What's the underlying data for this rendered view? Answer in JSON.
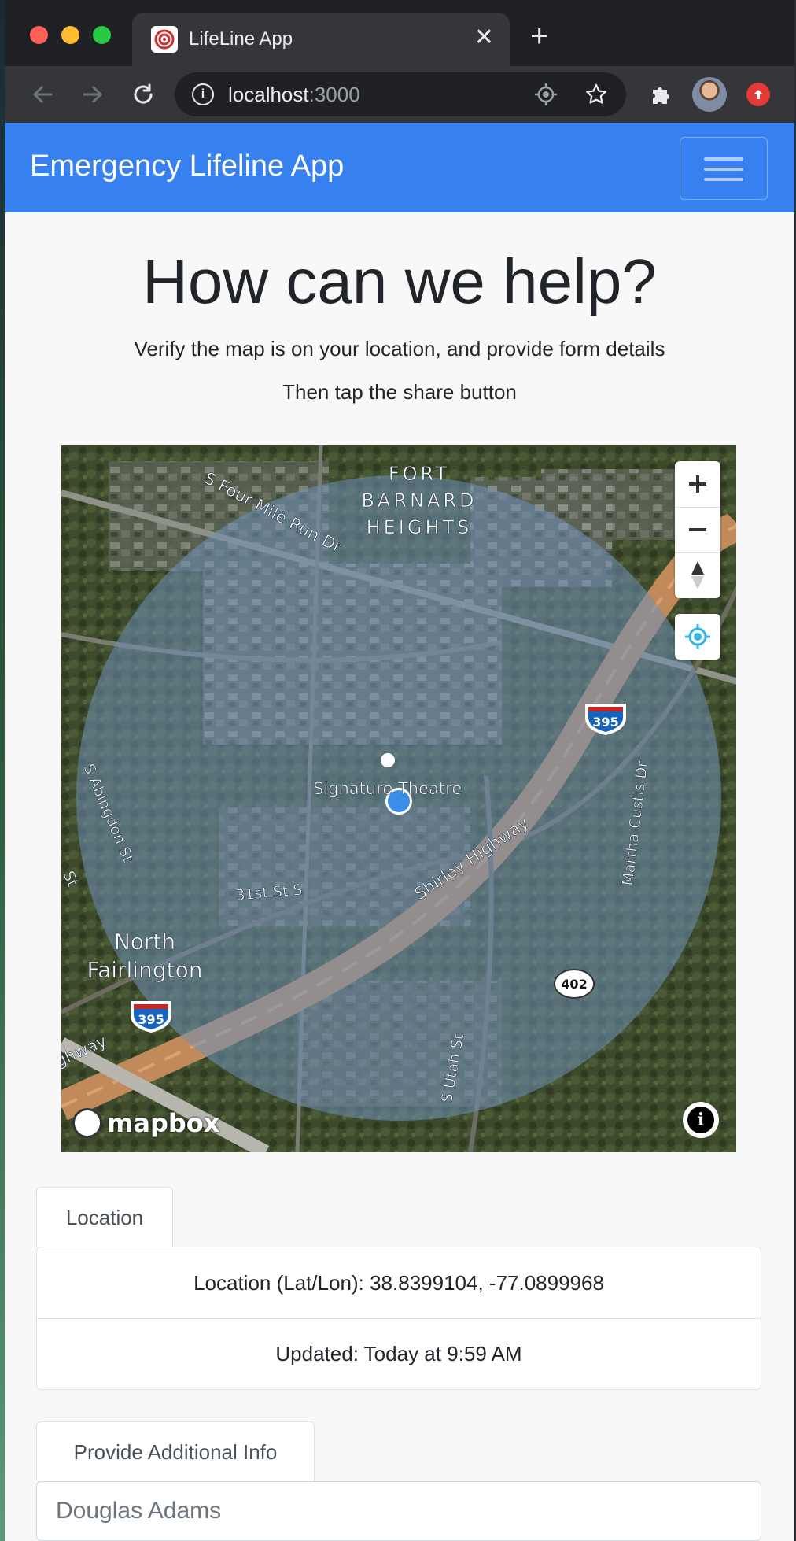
{
  "browser": {
    "tab_title": "LifeLine App",
    "url_host": "localhost",
    "url_port": ":3000"
  },
  "navbar": {
    "brand": "Emergency Lifeline App"
  },
  "hero": {
    "headline": "How can we help?",
    "line1": "Verify the map is on your location, and provide form details",
    "line2": "Then tap the share button"
  },
  "map": {
    "labels": {
      "area1": "FORT",
      "area2": "BARNARD",
      "area3": "HEIGHTS",
      "street1": "S Four Mile Run Dr",
      "poi": "Signature Theatre",
      "highway": "Shirley Highway",
      "street2": "Martha Custis Dr",
      "street3": "S Abingdon St",
      "street4": "31st St S",
      "area4": "North",
      "area5": "Fairlington",
      "street5": "S Utah St",
      "shield1": "395",
      "shield2": "395",
      "shield3": "402",
      "edge1": "ghway",
      "edge2": "St"
    },
    "logo": "mapbox",
    "attrib": "i"
  },
  "location_tab": {
    "label": "Location",
    "coords": "Location (Lat/Lon): 38.8399104, -77.0899968",
    "updated": "Updated: Today at 9:59 AM"
  },
  "info_tab": {
    "label": "Provide Additional Info",
    "name_value": "Douglas Adams"
  },
  "colors": {
    "navbar": "#3780f0",
    "location_dot": "#3a8ee6",
    "accuracy_circle": "#6f8fb8"
  }
}
